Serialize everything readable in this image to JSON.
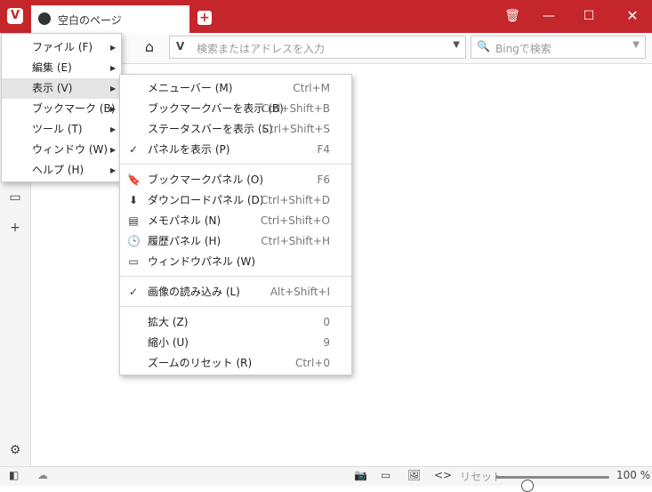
{
  "browser": {
    "logo": "V",
    "tab_title": "空白のページ",
    "new_tab": "+"
  },
  "window_controls": {
    "trash": "🗑",
    "minimize": "—",
    "maximize": "☐",
    "close": "✕"
  },
  "address": {
    "placeholder": "検索またはアドレスを入力",
    "logo": "V",
    "dropdown": "▼"
  },
  "search": {
    "placeholder": "Bingで検索",
    "icon": "🔍",
    "dropdown": "▼"
  },
  "menu_main": [
    {
      "label": "ファイル (F)"
    },
    {
      "label": "編集 (E)"
    },
    {
      "label": "表示 (V)"
    },
    {
      "label": "ブックマーク (B)"
    },
    {
      "label": "ツール (T)"
    },
    {
      "label": "ウィンドウ (W)"
    },
    {
      "label": "ヘルプ (H)"
    }
  ],
  "arrow": "▶",
  "menu_view": [
    {
      "label": "メニューバー (M)",
      "shortcut": "Ctrl+M",
      "icon": ""
    },
    {
      "label": "ブックマークバーを表示 (B)",
      "shortcut": "Ctrl+Shift+B",
      "icon": ""
    },
    {
      "label": "ステータスバーを表示 (S)",
      "shortcut": "Ctrl+Shift+S",
      "icon": ""
    },
    {
      "label": "パネルを表示 (P)",
      "shortcut": "F4",
      "icon": "✓"
    },
    {
      "label": "ブックマークパネル (O)",
      "shortcut": "F6",
      "icon": "🔖"
    },
    {
      "label": "ダウンロードパネル (D)",
      "shortcut": "Ctrl+Shift+D",
      "icon": "⬇"
    },
    {
      "label": "メモパネル (N)",
      "shortcut": "Ctrl+Shift+O",
      "icon": "▤"
    },
    {
      "label": "履歴パネル (H)",
      "shortcut": "Ctrl+Shift+H",
      "icon": "🕒"
    },
    {
      "label": "ウィンドウパネル (W)",
      "shortcut": "",
      "icon": "▭"
    },
    {
      "label": "画像の読み込み (L)",
      "shortcut": "Alt+Shift+I",
      "icon": "✓"
    },
    {
      "label": "拡大 (Z)",
      "shortcut": "0",
      "icon": ""
    },
    {
      "label": "縮小 (U)",
      "shortcut": "9",
      "icon": ""
    },
    {
      "label": "ズームのリセット (R)",
      "shortcut": "Ctrl+0",
      "icon": ""
    }
  ],
  "sidebar": {
    "window_icon": "▭",
    "add_icon": "+",
    "settings_icon": "⚙"
  },
  "status": {
    "panel_toggle": "◧",
    "cloud": "☁",
    "camera": "📷",
    "window": "▭",
    "image": "🖼",
    "code": "<>",
    "reset_label": "リセット",
    "zoom": "100 %",
    "zoom_value": 100
  }
}
